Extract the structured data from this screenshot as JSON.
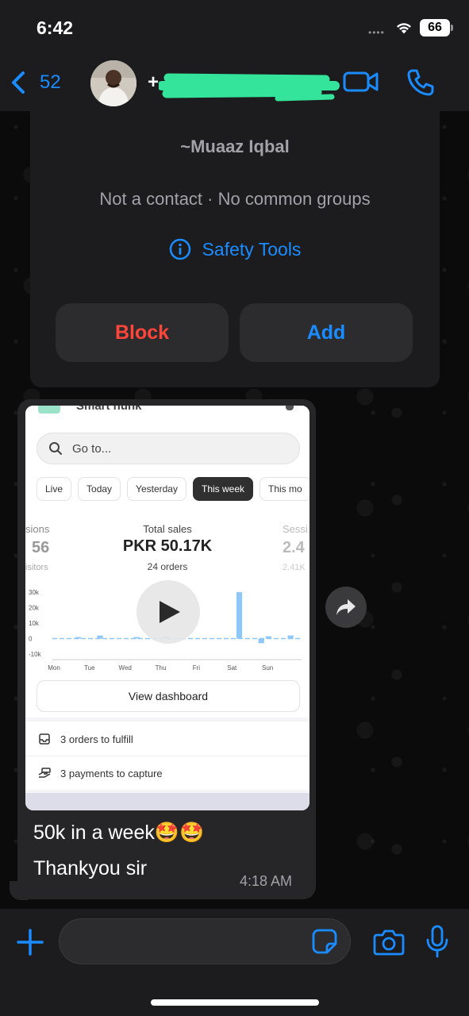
{
  "status_bar": {
    "time": "6:42",
    "signal": "••••",
    "battery": "66",
    "icons": [
      "wifi-icon",
      "battery-icon"
    ]
  },
  "header": {
    "back_count": "52",
    "contact_visible_prefix": "+",
    "icons": [
      "chevron-left-icon",
      "video-call-icon",
      "phone-icon"
    ],
    "accent_color": "#1a8cff",
    "redaction_color": "#35e49b"
  },
  "contact_card": {
    "name": "~Muaaz Iqbal",
    "subtitle": "Not a contact · No common groups",
    "safety_tools_label": "Safety Tools",
    "block_label": "Block",
    "add_label": "Add",
    "block_color": "#ff453a"
  },
  "message": {
    "video_preview": {
      "header_text": "Smart hunk",
      "search_placeholder": "Go to...",
      "range_tabs": [
        "Live",
        "Today",
        "Yesterday",
        "This week",
        "This mo"
      ],
      "active_tab": "This week",
      "left_stat": {
        "label": "sions",
        "value": "56",
        "sub": "isitors"
      },
      "center_stat": {
        "label": "Total sales",
        "value": "PKR 50.17K",
        "sub": "24 orders"
      },
      "right_stat": {
        "label": "Sessi",
        "value": "2.4",
        "sub": "2.41K"
      },
      "view_dashboard_label": "View dashboard",
      "tasks": [
        "3 orders to fulfill",
        "3 payments to capture"
      ]
    },
    "text_line_1": "50k in a week🤩🤩",
    "text_line_2": "Thankyou sir",
    "time": "4:18 AM"
  },
  "input_bar": {
    "placeholder": "",
    "icons": [
      "plus-icon",
      "sticker-icon",
      "camera-icon",
      "microphone-icon"
    ]
  },
  "chart_data": {
    "type": "bar",
    "title": "",
    "xlabel": "",
    "ylabel": "",
    "ylim": [
      -10000,
      30000
    ],
    "yticks": [
      "30k",
      "20k",
      "10k",
      "0",
      "-10k"
    ],
    "categories": [
      "Mon",
      "Tue",
      "Wed",
      "Thu",
      "Fri",
      "Sat",
      "Sun"
    ],
    "x_tick_labels": [
      "Mon",
      "Tue",
      "Wed",
      "Thu",
      "Fri",
      "Sat",
      "Sun"
    ],
    "values": [
      0,
      0,
      0,
      1000,
      0,
      0,
      2000,
      0,
      0,
      0,
      0,
      1000,
      0,
      0,
      0,
      1500,
      0,
      0,
      0,
      0,
      0,
      0,
      0,
      0,
      0,
      30000,
      0,
      0,
      -3000,
      1500,
      0,
      0,
      2000,
      0
    ],
    "color": "#8fc8f8",
    "grid": false
  }
}
